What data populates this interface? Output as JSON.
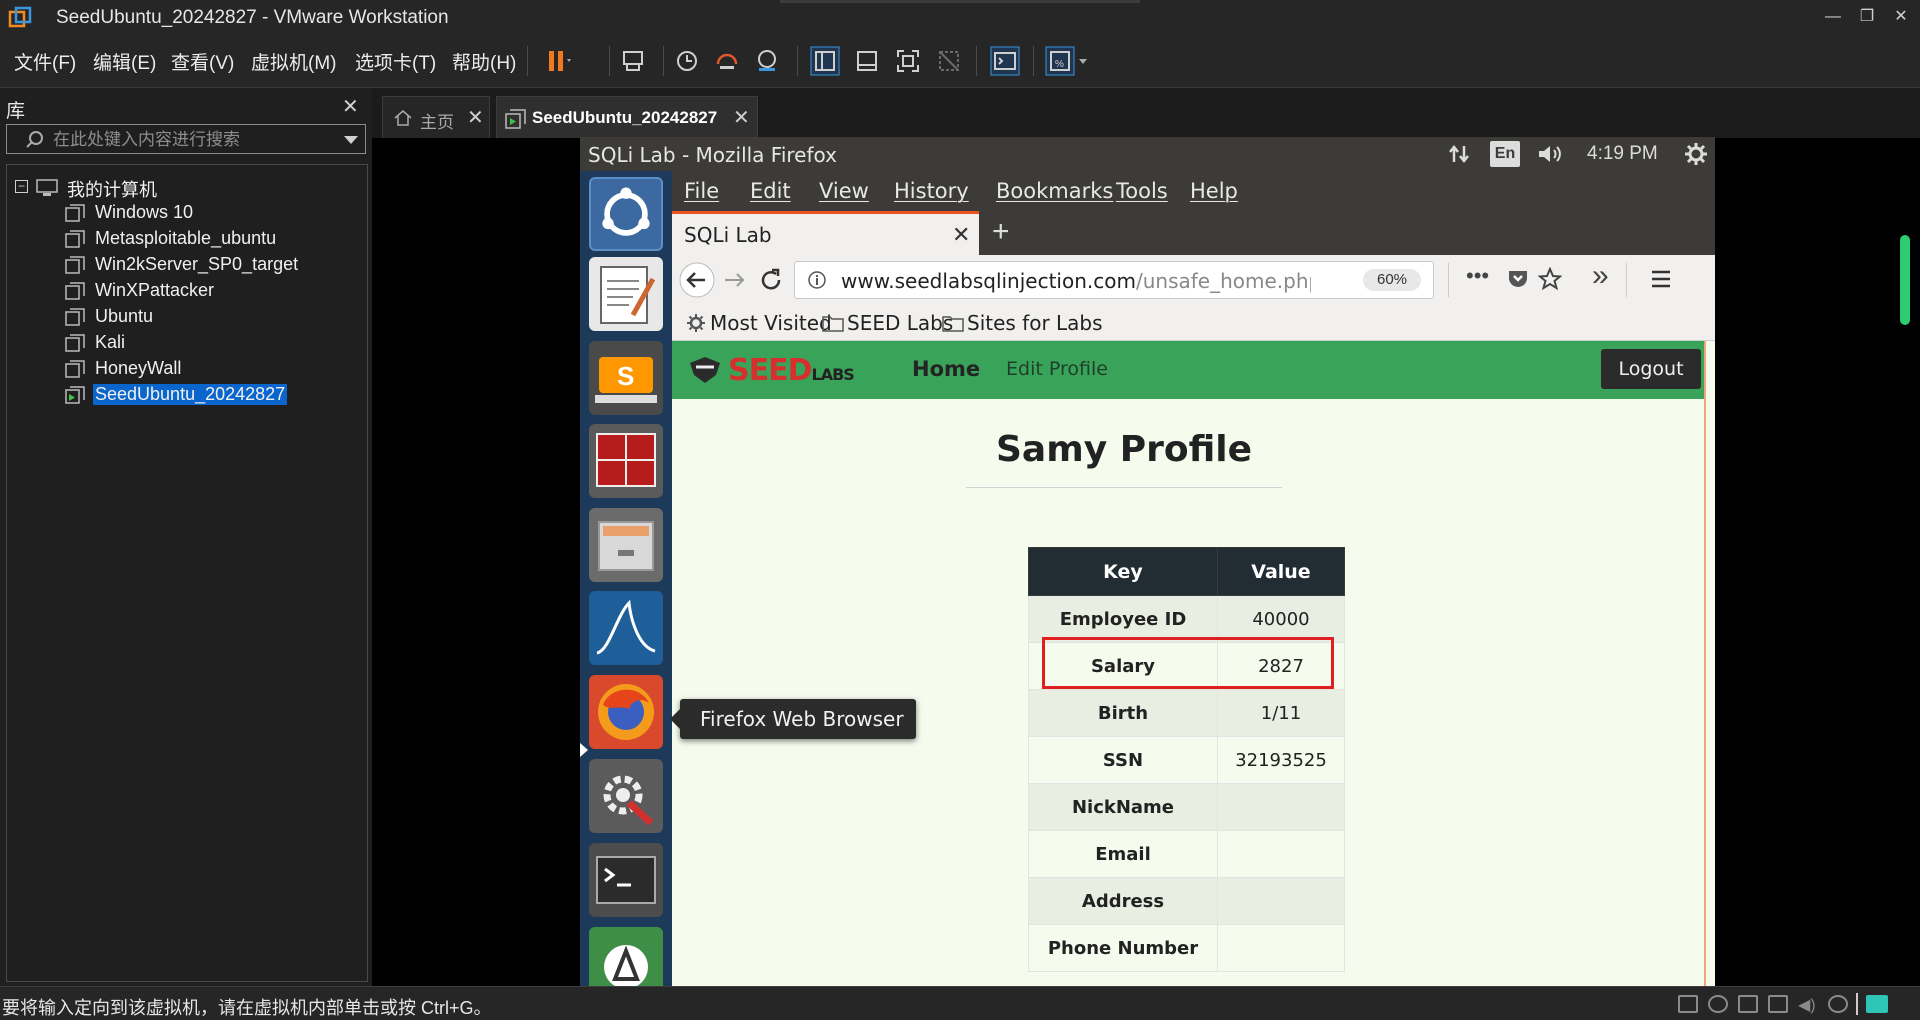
{
  "window": {
    "title": "SeedUbuntu_20242827 - VMware Workstation"
  },
  "menu": [
    "文件(F)",
    "编辑(E)",
    "查看(V)",
    "虚拟机(M)",
    "选项卡(T)",
    "帮助(H)"
  ],
  "library": {
    "title": "库",
    "search_placeholder": "在此处键入内容进行搜索",
    "root": "我的计算机",
    "items": [
      "Windows 10",
      "Metasploitable_ubuntu",
      "Win2kServer_SP0_target",
      "WinXPattacker",
      "Ubuntu",
      "Kali",
      "HoneyWall",
      "SeedUbuntu_20242827"
    ],
    "selected": "SeedUbuntu_20242827"
  },
  "tabs": [
    {
      "label": "主页"
    },
    {
      "label": "SeedUbuntu_20242827"
    }
  ],
  "ubuntu": {
    "window_title": "SQLi Lab - Mozilla Firefox",
    "lang": "En",
    "clock": "4:19 PM",
    "tooltip": "Firefox Web Browser"
  },
  "firefox": {
    "menu": [
      "File",
      "Edit",
      "View",
      "History",
      "Bookmarks",
      "Tools",
      "Help"
    ],
    "tab_title": "SQLi Lab",
    "url_host": "www.seedlabsqlinjection.com",
    "url_path": "/unsafe_home.php",
    "zoom": "60%",
    "bookmarks": [
      "Most Visited",
      "SEED Labs",
      "Sites for Labs"
    ]
  },
  "page": {
    "brand": "SEED",
    "brand_small": "LABS",
    "nav_home": "Home",
    "nav_edit": "Edit Profile",
    "logout": "Logout",
    "profile_title": "Samy Profile",
    "table_header": {
      "key": "Key",
      "value": "Value"
    },
    "rows": [
      {
        "key": "Employee ID",
        "value": "40000"
      },
      {
        "key": "Salary",
        "value": "2827"
      },
      {
        "key": "Birth",
        "value": "1/11"
      },
      {
        "key": "SSN",
        "value": "32193525"
      },
      {
        "key": "NickName",
        "value": ""
      },
      {
        "key": "Email",
        "value": ""
      },
      {
        "key": "Address",
        "value": ""
      },
      {
        "key": "Phone Number",
        "value": ""
      }
    ]
  },
  "status": {
    "message": "要将输入定向到该虚拟机，请在虚拟机内部单击或按 Ctrl+G。"
  },
  "colors": {
    "accent": "#0a66cc",
    "seed_green": "#3aa35a",
    "highlight": "#e02020",
    "ubuntu_orange": "#e95420"
  }
}
